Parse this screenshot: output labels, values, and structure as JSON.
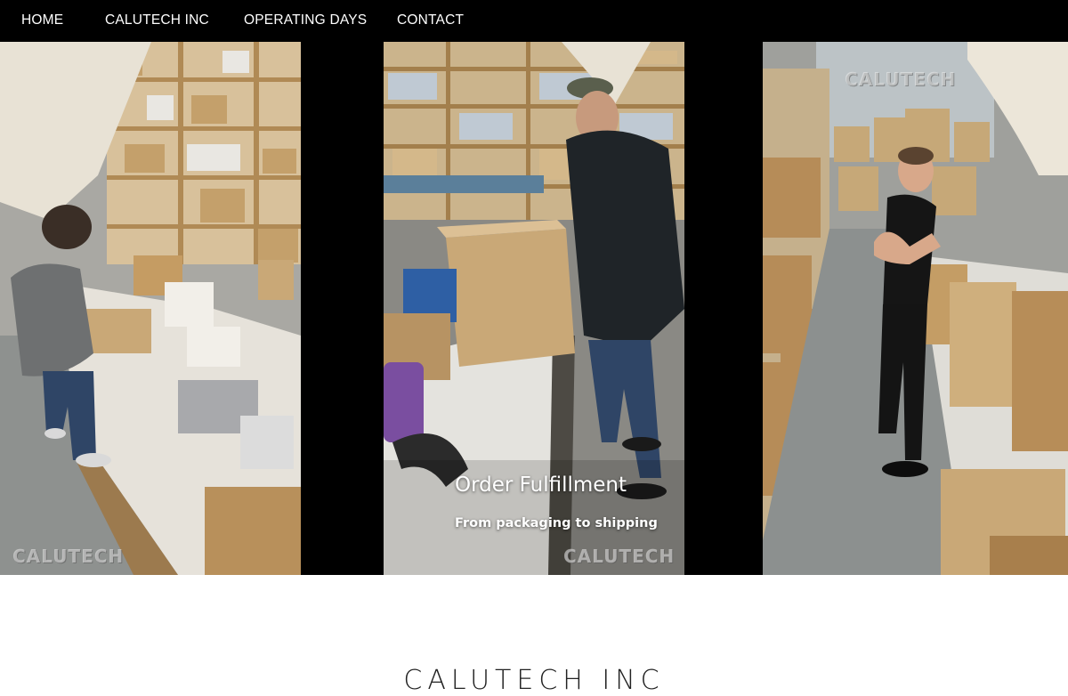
{
  "nav": {
    "items": [
      {
        "label": "HOME"
      },
      {
        "label": "CALUTECH INC"
      },
      {
        "label": "OPERATING DAYS"
      },
      {
        "label": "CONTACT"
      }
    ]
  },
  "gallery": {
    "watermark": "CALUTECH",
    "caption": {
      "title": "Order Fulfillment",
      "subtitle": "From packaging to shipping"
    }
  },
  "section": {
    "heading": "CALUTECH INC"
  },
  "colors": {
    "nav_bg": "#000000",
    "nav_text": "#ffffff",
    "page_bg": "#ffffff",
    "cardboard": "#c9a877"
  }
}
